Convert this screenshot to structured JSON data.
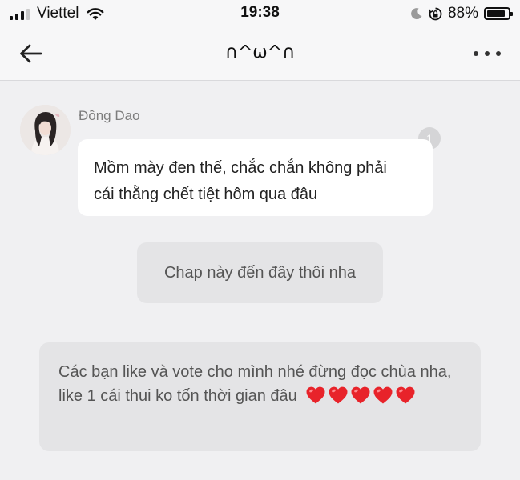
{
  "status_bar": {
    "carrier": "Viettel",
    "time": "19:38",
    "battery_percent": "88%",
    "battery_level": 0.88,
    "icons": [
      "signal-bars-icon",
      "wifi-icon",
      "moon-icon",
      "rotation-lock-icon",
      "battery-icon"
    ]
  },
  "nav": {
    "title": "∩^ω^∩",
    "back_icon": "arrow-left-icon",
    "more_icon": "more-dots-icon"
  },
  "message": {
    "sender": "Đồng Dao",
    "text_line1": "Mồm mày đen thế, chắc chắn không phải",
    "text_line2": "cái thằng chết tiệt hôm qua đâu",
    "read_count": "1"
  },
  "system_note": {
    "text": "Chap này đến đây thôi nha"
  },
  "author_note": {
    "text": "Các bạn like và vote cho mình nhé đừng đọc chùa nha, like 1 cái thui ko tốn thời gian đâu",
    "heart_count": 5,
    "heart_icon": "red-heart-icon",
    "heart_color": "#e8232a"
  }
}
